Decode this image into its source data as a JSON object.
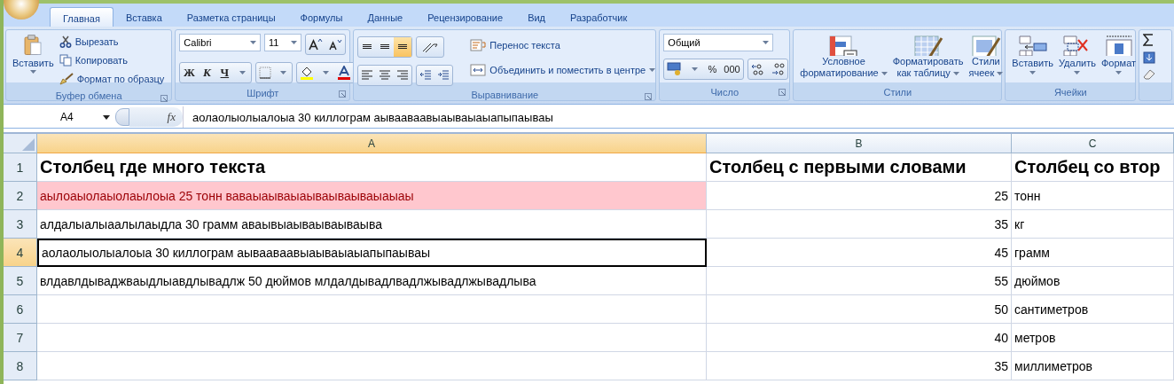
{
  "tabs": [
    {
      "label": "Главная",
      "selected": true
    },
    {
      "label": "Вставка",
      "selected": false
    },
    {
      "label": "Разметка страницы",
      "selected": false
    },
    {
      "label": "Формулы",
      "selected": false
    },
    {
      "label": "Данные",
      "selected": false
    },
    {
      "label": "Рецензирование",
      "selected": false
    },
    {
      "label": "Вид",
      "selected": false
    },
    {
      "label": "Разработчик",
      "selected": false
    }
  ],
  "ribbon": {
    "clipboard": {
      "title": "Буфер обмена",
      "paste": "Вставить",
      "cut": "Вырезать",
      "copy": "Копировать",
      "format_painter": "Формат по образцу"
    },
    "font": {
      "title": "Шрифт",
      "name": "Calibri",
      "size": "11",
      "bold": "Ж",
      "italic": "К",
      "underline": "Ч"
    },
    "alignment": {
      "title": "Выравнивание",
      "vertical": [
        {
          "selected": false
        },
        {
          "selected": false
        },
        {
          "selected": true
        }
      ],
      "wrap": "Перенос текста",
      "merge": "Объединить и поместить в центре"
    },
    "number": {
      "title": "Число",
      "format": "Общий",
      "percent": "%",
      "thousands": "000"
    },
    "styles": {
      "title": "Стили",
      "buttons": [
        {
          "kind": "conditional",
          "lines": [
            "Условное",
            "форматирование"
          ]
        },
        {
          "kind": "table",
          "lines": [
            "Форматировать",
            "как таблицу"
          ]
        },
        {
          "kind": "cell",
          "lines": [
            "Стили",
            "ячеек"
          ]
        }
      ]
    },
    "cells": {
      "title": "Ячейки",
      "buttons": [
        {
          "kind": "insert",
          "label": "Вставить"
        },
        {
          "kind": "delete",
          "label": "Удалить"
        },
        {
          "kind": "format",
          "label": "Формат"
        }
      ]
    }
  },
  "formula_bar": {
    "name_box": "A4",
    "function_label": "fx",
    "formula": "аолаолыолыалоыа 30 киллограм аывааваавыаываыаыапыпаываы"
  },
  "sheet": {
    "columns": [
      {
        "label": "A",
        "selected": true
      },
      {
        "label": "B",
        "selected": false
      },
      {
        "label": "C",
        "selected": false
      }
    ],
    "rows": [
      {
        "number": "1",
        "selected": false,
        "bold": true,
        "highlighted": false,
        "a": "Столбец где много текста",
        "b": "Столбец с первыми словами",
        "c": "Столбец со втор"
      },
      {
        "number": "2",
        "selected": false,
        "bold": false,
        "highlighted": true,
        "a": "аылоаыолаыолаылоыа 25 тонн ваваыаываыаываываываыаыаы",
        "b": "25",
        "c": "тонн"
      },
      {
        "number": "3",
        "selected": false,
        "bold": false,
        "highlighted": false,
        "a": "алдалыалыаалылаыдла 30 грамм аваывыаываываываыва",
        "b": "35",
        "c": "кг"
      },
      {
        "number": "4",
        "selected": true,
        "bold": false,
        "highlighted": false,
        "a": "аолаолыолыалоыа 30 киллограм аывааваавыаываыаыапыпаываы",
        "b": "45",
        "c": "грамм"
      },
      {
        "number": "5",
        "selected": false,
        "bold": false,
        "highlighted": false,
        "a": "влдавлдываджваыдлыавдлывадлж 50 дюймов млдалдывадлвадлжывадлжывадлыва",
        "b": "55",
        "c": "дюймов"
      },
      {
        "number": "6",
        "selected": false,
        "bold": false,
        "highlighted": false,
        "a": "",
        "b": "50",
        "c": "сантиметров"
      },
      {
        "number": "7",
        "selected": false,
        "bold": false,
        "highlighted": false,
        "a": "",
        "b": "40",
        "c": "метров"
      },
      {
        "number": "8",
        "selected": false,
        "bold": false,
        "highlighted": false,
        "a": "",
        "b": "35",
        "c": "миллиметров"
      }
    ]
  }
}
